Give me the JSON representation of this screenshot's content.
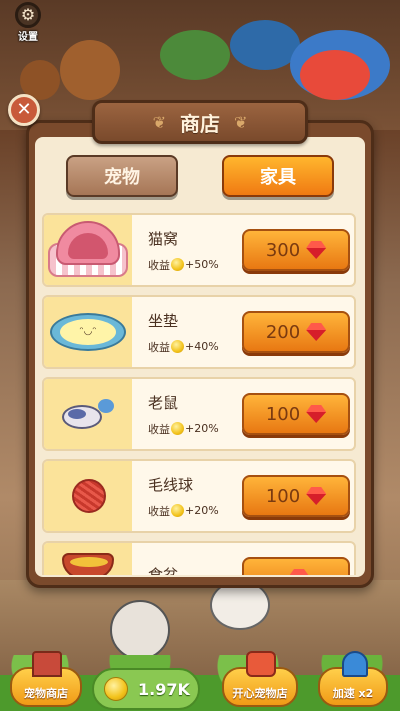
{
  "settings": {
    "label": "设置"
  },
  "shop": {
    "title": "商店",
    "tabs": [
      {
        "label": "宠物",
        "selected": false
      },
      {
        "label": "家具",
        "selected": true
      }
    ],
    "items": [
      {
        "name": "猫窝",
        "bonus": "+50%",
        "price": "300",
        "icon": "cat-bed-icon"
      },
      {
        "name": "坐垫",
        "bonus": "+40%",
        "price": "200",
        "icon": "cushion-icon"
      },
      {
        "name": "老鼠",
        "bonus": "+20%",
        "price": "100",
        "icon": "toy-mouse-icon"
      },
      {
        "name": "毛线球",
        "bonus": "+20%",
        "price": "100",
        "icon": "yarn-ball-icon"
      },
      {
        "name": "食盆",
        "bonus": "",
        "price": "",
        "icon": "food-bowl-icon"
      }
    ],
    "bonus_label": "收益",
    "currency_icon": "ruby-gem-icon"
  },
  "bottom_bar": {
    "pet_shop_label": "宠物商店",
    "coins": "1.97K",
    "happy_shop_label": "开心宠物店",
    "speed_label": "加速 x2"
  },
  "colors": {
    "accent_orange": "#f07a12",
    "panel_brown": "#7a4a2c",
    "gem_red": "#d61e2a"
  }
}
